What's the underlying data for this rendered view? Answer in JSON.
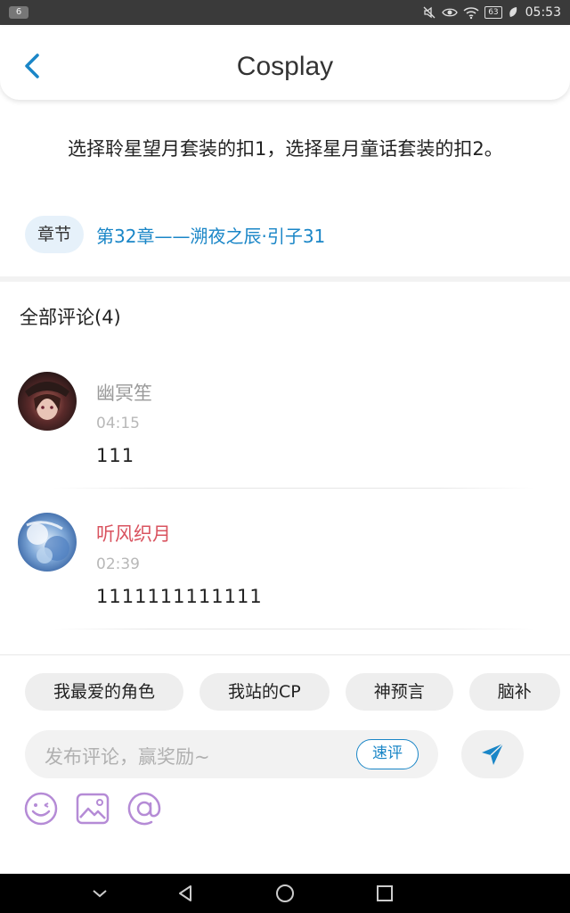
{
  "status_bar": {
    "notification_count": "6",
    "battery": "63",
    "time": "05:53",
    "icons": [
      "mute-icon",
      "eye-comfort-icon",
      "wifi-icon",
      "battery-icon",
      "charging-leaf-icon"
    ]
  },
  "header": {
    "title": "Cosplay",
    "back_icon": "chevron-left-icon"
  },
  "content": {
    "text": "选择聆星望月套装的扣1，选择星月童话套装的扣2。",
    "chapter_tag": "章节",
    "chapter_link": "第32章——溯夜之辰·引子31"
  },
  "comments": {
    "title": "全部评论(4)",
    "items": [
      {
        "name": "幽冥笙",
        "name_color": "#9a9a9a",
        "time": "04:15",
        "text": "111"
      },
      {
        "name": "听风织月",
        "name_color": "#d9535f",
        "time": "02:39",
        "text": "1111111111111"
      }
    ]
  },
  "input_panel": {
    "chips": [
      "我最爱的角色",
      "我站的CP",
      "神预言",
      "脑补"
    ],
    "placeholder": "发布评论，赢奖励~",
    "quick_review": "速评",
    "send_icon": "send-icon",
    "tool_icons": [
      "emoji-icon",
      "image-icon",
      "at-icon"
    ]
  },
  "colors": {
    "accent": "#1a86c7",
    "tool_icon": "#b58bd6"
  }
}
